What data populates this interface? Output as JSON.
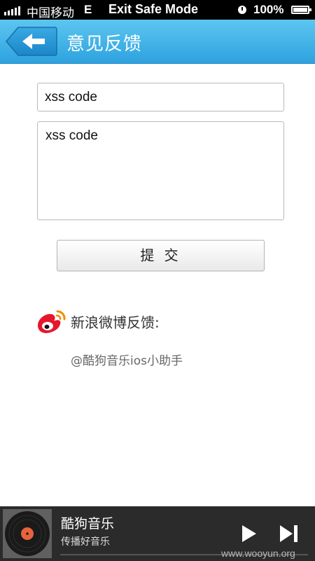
{
  "status_bar": {
    "carrier": "中国移动",
    "network": "E",
    "mode_text": "Exit Safe Mode",
    "battery": "100%"
  },
  "header": {
    "title": "意见反馈",
    "back_icon": "back-arrow-icon"
  },
  "form": {
    "contact_value": "xss code",
    "content_value": "xss code",
    "submit_label": "提 交"
  },
  "weibo": {
    "label": "新浪微博反馈:",
    "account": "@酷狗音乐ios小助手",
    "icon": "weibo-icon"
  },
  "player": {
    "song": "酷狗音乐",
    "artist": "传播好音乐",
    "play_icon": "play-icon",
    "next_icon": "next-track-icon"
  },
  "watermark": "www.wooyun.org",
  "colors": {
    "header_top": "#5cc6f0",
    "header_bottom": "#2ea2df",
    "player_bg": "#2b2b2b"
  }
}
